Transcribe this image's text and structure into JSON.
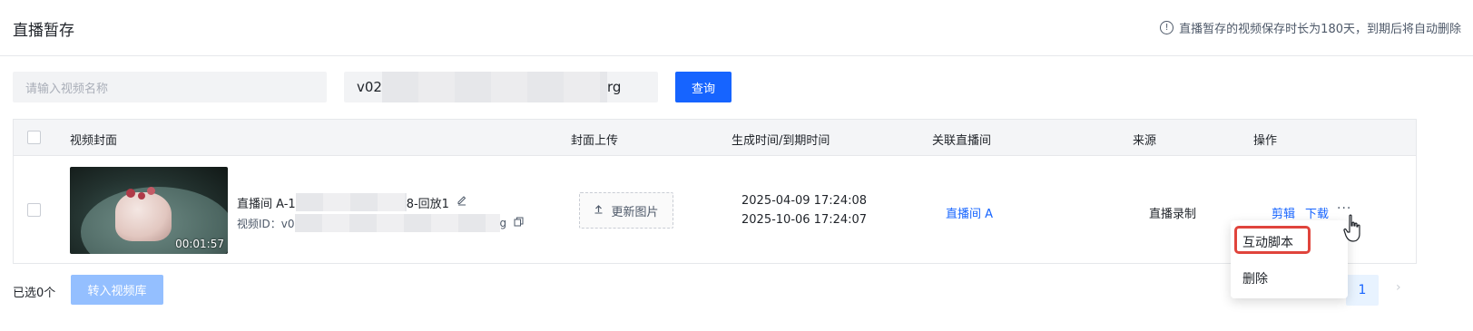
{
  "header": {
    "title": "直播暂存",
    "notice": "直播暂存的视频保存时长为180天，到期后将自动删除"
  },
  "filters": {
    "name_placeholder": "请输入视频名称",
    "id_prefix": "v02",
    "id_suffix": "rg",
    "query_button": "查询"
  },
  "table": {
    "columns": {
      "cover": "视频封面",
      "upload": "封面上传",
      "time": "生成时间/到期时间",
      "room": "关联直播间",
      "source": "来源",
      "ops": "操作"
    },
    "rows": [
      {
        "duration": "00:01:57",
        "name_prefix": "直播间 A-1",
        "name_suffix": "8-回放1",
        "id_label": "视频ID：v0",
        "id_suffix": "g",
        "upload_label": "更新图片",
        "created": "2025-04-09 17:24:08",
        "expires": "2025-10-06 17:24:07",
        "room": "直播间 A",
        "source": "直播录制",
        "edit": "剪辑",
        "download": "下载"
      }
    ]
  },
  "footer": {
    "selected": "已选0个",
    "transfer_button": "转入视频库",
    "page": "1"
  },
  "dropdown": {
    "items": [
      "互动脚本",
      "删除"
    ]
  }
}
